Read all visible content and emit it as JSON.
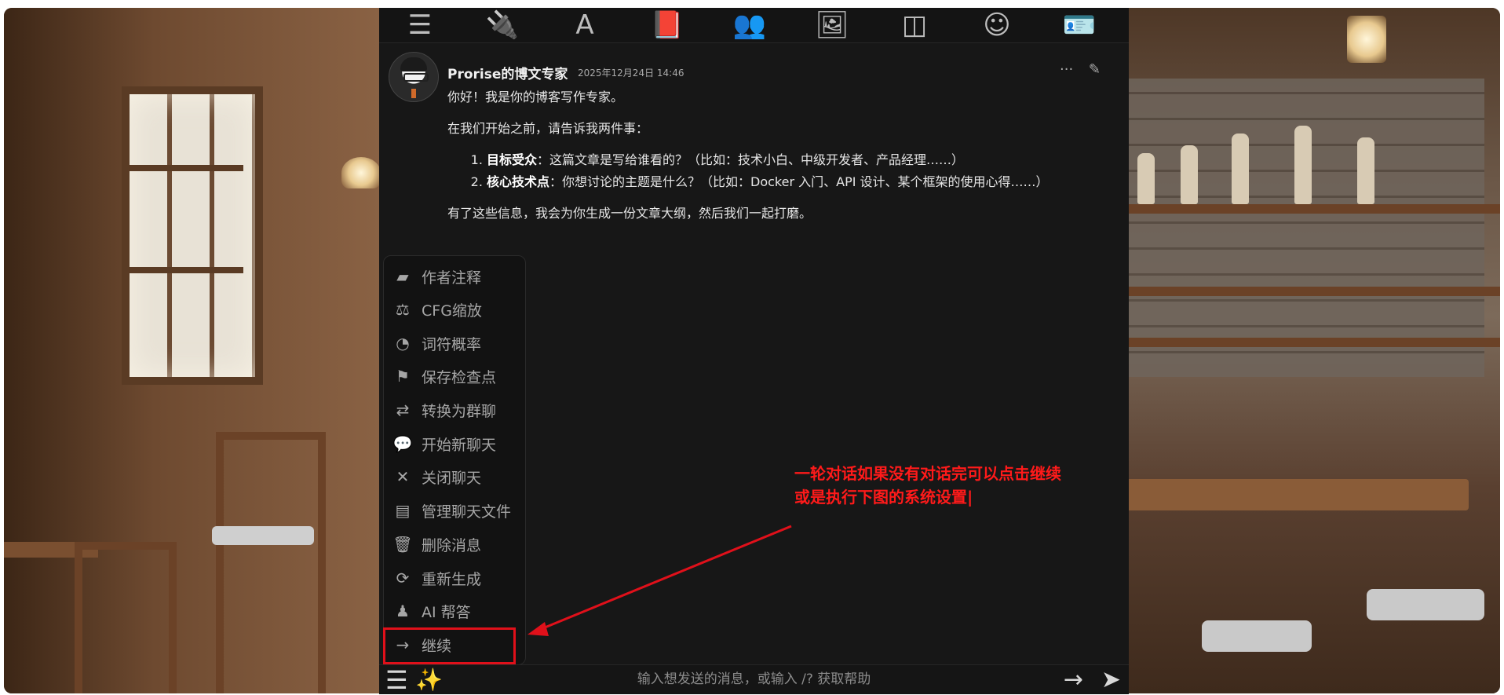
{
  "toolbar": {
    "icons": [
      {
        "name": "sliders-icon",
        "glyph": "☰"
      },
      {
        "name": "plug-icon",
        "glyph": "🔌"
      },
      {
        "name": "font-icon",
        "glyph": "A"
      },
      {
        "name": "book-icon",
        "glyph": "📕"
      },
      {
        "name": "user-gear-icon",
        "glyph": "👥"
      },
      {
        "name": "image-icon",
        "glyph": "🖼"
      },
      {
        "name": "cubes-icon",
        "glyph": "◫"
      },
      {
        "name": "face-smile-icon",
        "glyph": "☺"
      },
      {
        "name": "address-card-icon",
        "glyph": "🪪"
      }
    ]
  },
  "message": {
    "name": "Prorise的博文专家",
    "time": "2025年12月24日 14:46",
    "more_glyph": "···",
    "edit_glyph": "✎",
    "greeting": "你好！我是你的博客写作专家。",
    "intro": "在我们开始之前，请告诉我两件事：",
    "items": [
      {
        "bold": "目标受众",
        "text": "：这篇文章是写给谁看的？（比如：技术小白、中级开发者、产品经理……）"
      },
      {
        "bold": "核心技术点",
        "text": "：你想讨论的主题是什么？（比如：Docker 入门、API 设计、某个框架的使用心得……）"
      }
    ],
    "closing": "有了这些信息，我会为你生成一份文章大纲，然后我们一起打磨。"
  },
  "menu": {
    "items": [
      {
        "label": "作者注释",
        "icon": "note-icon",
        "glyph": "▰"
      },
      {
        "label": "CFG缩放",
        "icon": "scale-balanced-icon",
        "glyph": "⚖"
      },
      {
        "label": "词符概率",
        "icon": "chart-pie-icon",
        "glyph": "◔"
      },
      {
        "label": "保存检查点",
        "icon": "flag-icon",
        "glyph": "⚑"
      },
      {
        "label": "转换为群聊",
        "icon": "people-arrows-icon",
        "glyph": "⇄"
      },
      {
        "label": "开始新聊天",
        "icon": "comments-icon",
        "glyph": "💬"
      },
      {
        "label": "关闭聊天",
        "icon": "xmark-icon",
        "glyph": "✕"
      },
      {
        "label": "管理聊天文件",
        "icon": "address-book-icon",
        "glyph": "▤"
      },
      {
        "label": "删除消息",
        "icon": "trash-icon",
        "glyph": "🗑"
      },
      {
        "label": "重新生成",
        "icon": "repeat-icon",
        "glyph": "⟳"
      },
      {
        "label": "AI 帮答",
        "icon": "user-secret-icon",
        "glyph": "♟"
      },
      {
        "label": "继续",
        "icon": "arrow-right-icon",
        "glyph": "→"
      }
    ]
  },
  "annotation": {
    "line1": "一轮对话如果没有对话完可以点击继续",
    "line2": "或是执行下图的系统设置|",
    "color": "#e0101a"
  },
  "input": {
    "placeholder": "输入想发送的消息，或输入 /? 获取帮助",
    "options_glyph": "☰",
    "wand_glyph": "✨",
    "continue_glyph": "→",
    "send_glyph": "➤"
  }
}
